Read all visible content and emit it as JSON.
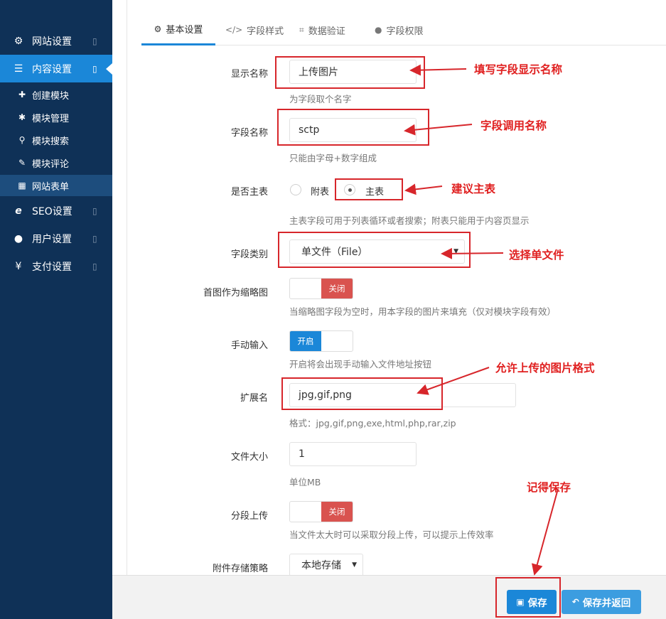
{
  "sidebar": {
    "items": [
      {
        "icon": "gear-icon",
        "glyph": "⚙",
        "label": "网站设置",
        "caret": "▯"
      },
      {
        "icon": "menu-icon",
        "glyph": "☰",
        "label": "内容设置",
        "caret": "▯"
      },
      {
        "icon": "globe-icon",
        "glyph": "e",
        "label": "SEO设置",
        "caret": "▯"
      },
      {
        "icon": "user-icon",
        "glyph": "●",
        "label": "用户设置",
        "caret": "▯"
      },
      {
        "icon": "yen-icon",
        "glyph": "¥",
        "label": "支付设置",
        "caret": "▯"
      }
    ],
    "subitems": [
      {
        "icon": "plus-icon",
        "glyph": "✚",
        "label": "创建模块"
      },
      {
        "icon": "cogs-icon",
        "glyph": "✱",
        "label": "模块管理"
      },
      {
        "icon": "search-icon",
        "glyph": "⚲",
        "label": "模块搜索"
      },
      {
        "icon": "comments-icon",
        "glyph": "✎",
        "label": "模块评论"
      },
      {
        "icon": "table-icon",
        "glyph": "▦",
        "label": "网站表单"
      }
    ]
  },
  "tabs": [
    {
      "icon": "gear-icon",
      "glyph": "⚙",
      "label": "基本设置"
    },
    {
      "icon": "code-icon",
      "glyph": "</>",
      "label": "字段样式"
    },
    {
      "icon": "crop-icon",
      "glyph": "⌗",
      "label": "数据验证"
    },
    {
      "icon": "user-icon",
      "glyph": "●",
      "label": "字段权限"
    }
  ],
  "form": {
    "display_name": {
      "label": "显示名称",
      "value": "上传图片",
      "help": "为字段取个名字"
    },
    "field_name": {
      "label": "字段名称",
      "value": "sctp",
      "help": "只能由字母+数字组成"
    },
    "main_table": {
      "label": "是否主表",
      "option_sub": "附表",
      "option_main": "主表",
      "selected": "主表",
      "help": "主表字段可用于列表循环或者搜索；附表只能用于内容页显示"
    },
    "field_type": {
      "label": "字段类别",
      "value": "单文件（File）"
    },
    "first_thumb": {
      "label": "首图作为缩略图",
      "state": "关闭",
      "help": "当缩略图字段为空时，用本字段的图片来填充（仅对模块字段有效）"
    },
    "manual_input": {
      "label": "手动输入",
      "state": "开启",
      "help": "开启将会出现手动输入文件地址按钮"
    },
    "extensions": {
      "label": "扩展名",
      "value": "jpg,gif,png",
      "help": "格式：jpg,gif,png,exe,html,php,rar,zip"
    },
    "file_size": {
      "label": "文件大小",
      "value": "1",
      "help": "单位MB"
    },
    "chunk_upload": {
      "label": "分段上传",
      "state": "关闭",
      "help": "当文件太大时可以采取分段上传，可以提示上传效率"
    },
    "storage": {
      "label": "附件存储策略",
      "value": "本地存储"
    }
  },
  "footer": {
    "save_label": "保存",
    "save_return_label": "保存并返回"
  },
  "annotations": {
    "a1": "填写字段显示名称",
    "a2": "字段调用名称",
    "a3": "建议主表",
    "a4": "选择单文件",
    "a5": "允许上传的图片格式",
    "a6": "记得保存"
  },
  "colors": {
    "sidebar_bg": "#0f3157",
    "accent": "#1b87d8",
    "switch_off": "#d9534f",
    "annotation_red": "#e02020"
  }
}
